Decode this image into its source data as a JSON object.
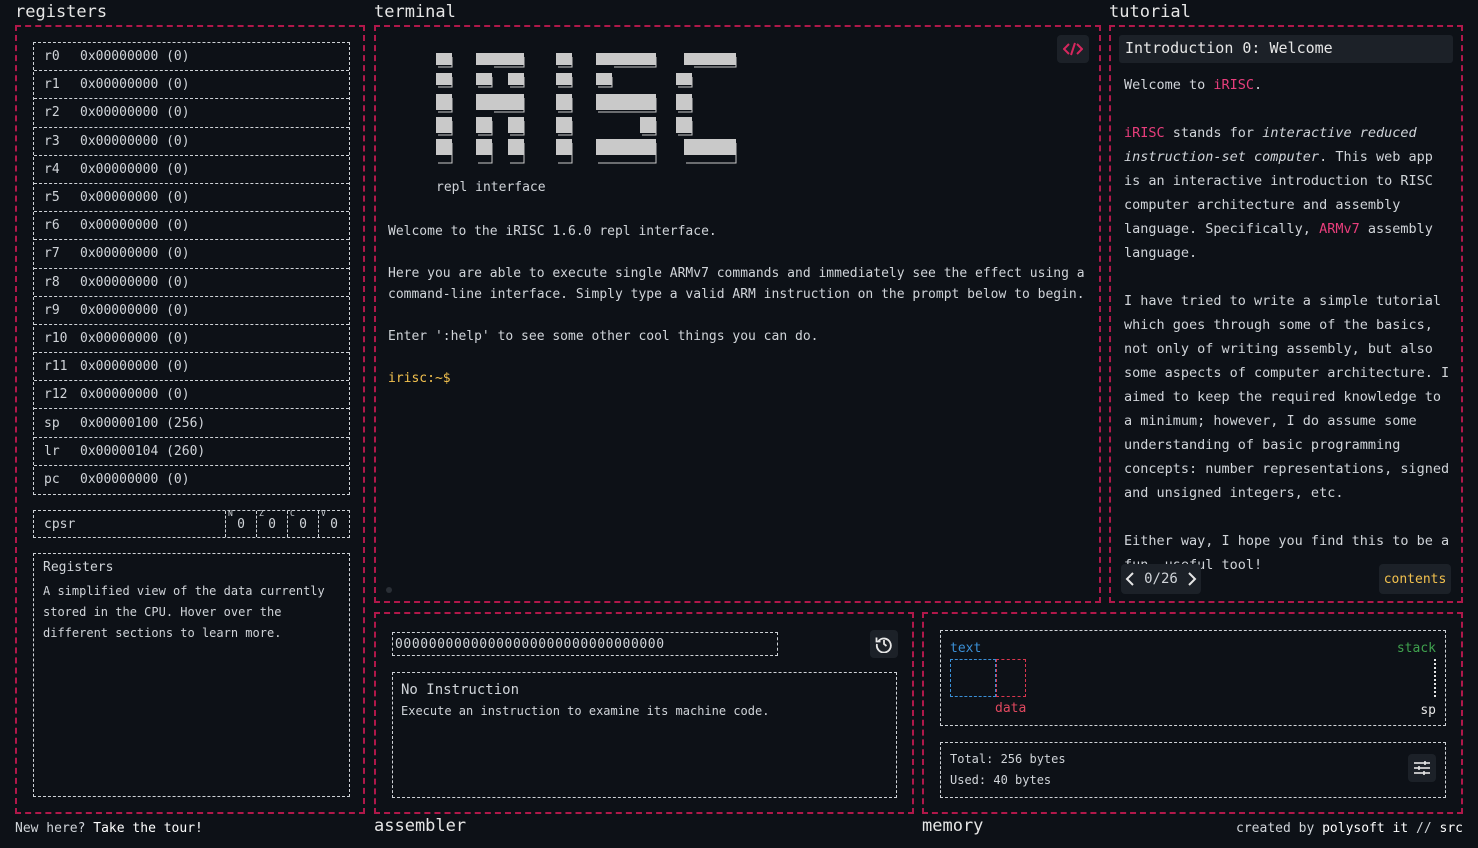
{
  "panels": {
    "registers_title": "registers",
    "terminal_title": "terminal",
    "tutorial_title": "tutorial",
    "assembler_title": "assembler",
    "memory_title": "memory"
  },
  "registers": [
    {
      "name": "r0",
      "value": "0x00000000 (0)"
    },
    {
      "name": "r1",
      "value": "0x00000000 (0)"
    },
    {
      "name": "r2",
      "value": "0x00000000 (0)"
    },
    {
      "name": "r3",
      "value": "0x00000000 (0)"
    },
    {
      "name": "r4",
      "value": "0x00000000 (0)"
    },
    {
      "name": "r5",
      "value": "0x00000000 (0)"
    },
    {
      "name": "r6",
      "value": "0x00000000 (0)"
    },
    {
      "name": "r7",
      "value": "0x00000000 (0)"
    },
    {
      "name": "r8",
      "value": "0x00000000 (0)"
    },
    {
      "name": "r9",
      "value": "0x00000000 (0)"
    },
    {
      "name": "r10",
      "value": "0x00000000 (0)"
    },
    {
      "name": "r11",
      "value": "0x00000000 (0)"
    },
    {
      "name": "r12",
      "value": "0x00000000 (0)"
    },
    {
      "name": "sp",
      "value": "0x00000100 (256)"
    },
    {
      "name": "lr",
      "value": "0x00000104 (260)"
    },
    {
      "name": "pc",
      "value": "0x00000000 (0)"
    }
  ],
  "cpsr": {
    "label": "cpsr",
    "flags": [
      {
        "letter": "N",
        "value": "0"
      },
      {
        "letter": "Z",
        "value": "0"
      },
      {
        "letter": "C",
        "value": "0"
      },
      {
        "letter": "V",
        "value": "0"
      }
    ]
  },
  "register_info": {
    "title": "Registers",
    "body": "A simplified view of the data currently stored in the CPU. Hover over the different sections to learn more."
  },
  "terminal": {
    "logo_subtitle": "repl interface",
    "welcome": "Welcome to the iRISC 1.6.0 repl interface.",
    "intro": "Here you are able to execute single ARMv7 commands and immediately see the effect using a command-line interface. Simply type a valid ARM instruction on the prompt below to begin.",
    "help": "Enter ':help' to see some other cool things you can do.",
    "prompt": "irisc:~$"
  },
  "tutorial": {
    "header": "Introduction 0: Welcome",
    "p1_pre": "Welcome to ",
    "p1_hl": "iRISC",
    "p1_post": ".",
    "p2_hl": "iRISC",
    "p2_a": " stands for ",
    "p2_em": "interactive reduced instruction-set computer",
    "p2_b": ". This web app is an interactive introduction to RISC computer architecture and assembly language. Specifically, ",
    "p2_hl2": "ARMv7",
    "p2_c": " assembly language.",
    "p3": "I have tried to write a simple tutorial which goes through some of the basics, not only of writing assembly, but also some aspects of computer architecture. I aimed to keep the required knowledge to a minimum; however, I do assume some understanding of basic programming concepts: number representations, signed and unsigned integers, etc.",
    "p4": "Either way, I hope you find this to be a fun, useful tool!",
    "page": "0/26",
    "contents": "contents"
  },
  "assembler": {
    "bits": "00000000000000000000000000000000",
    "instr_title": "No Instruction",
    "instr_desc": "Execute an instruction to examine its machine code."
  },
  "memory": {
    "text_label": "text",
    "stack_label": "stack",
    "data_label": "data",
    "sp_label": "sp",
    "total": "Total: 256 bytes",
    "used": "Used: 40 bytes"
  },
  "footer": {
    "tour_pre": "New here? ",
    "tour_link": "Take the tour!",
    "credit_pre": "created by ",
    "credit_author": "polysoft it",
    "credit_sep": " // ",
    "credit_src": "src"
  },
  "icons": {
    "code": "code-icon",
    "history": "history-icon",
    "settings": "sliders-icon",
    "prev": "chevron-left-icon",
    "next": "chevron-right-icon"
  },
  "colors": {
    "panel_border": "#b0184a",
    "highlight": "#e83e7c",
    "prompt": "#f2c14e",
    "text_segment": "#3a8fd6",
    "data_segment": "#d9364f",
    "stack_segment": "#3fa14e"
  }
}
